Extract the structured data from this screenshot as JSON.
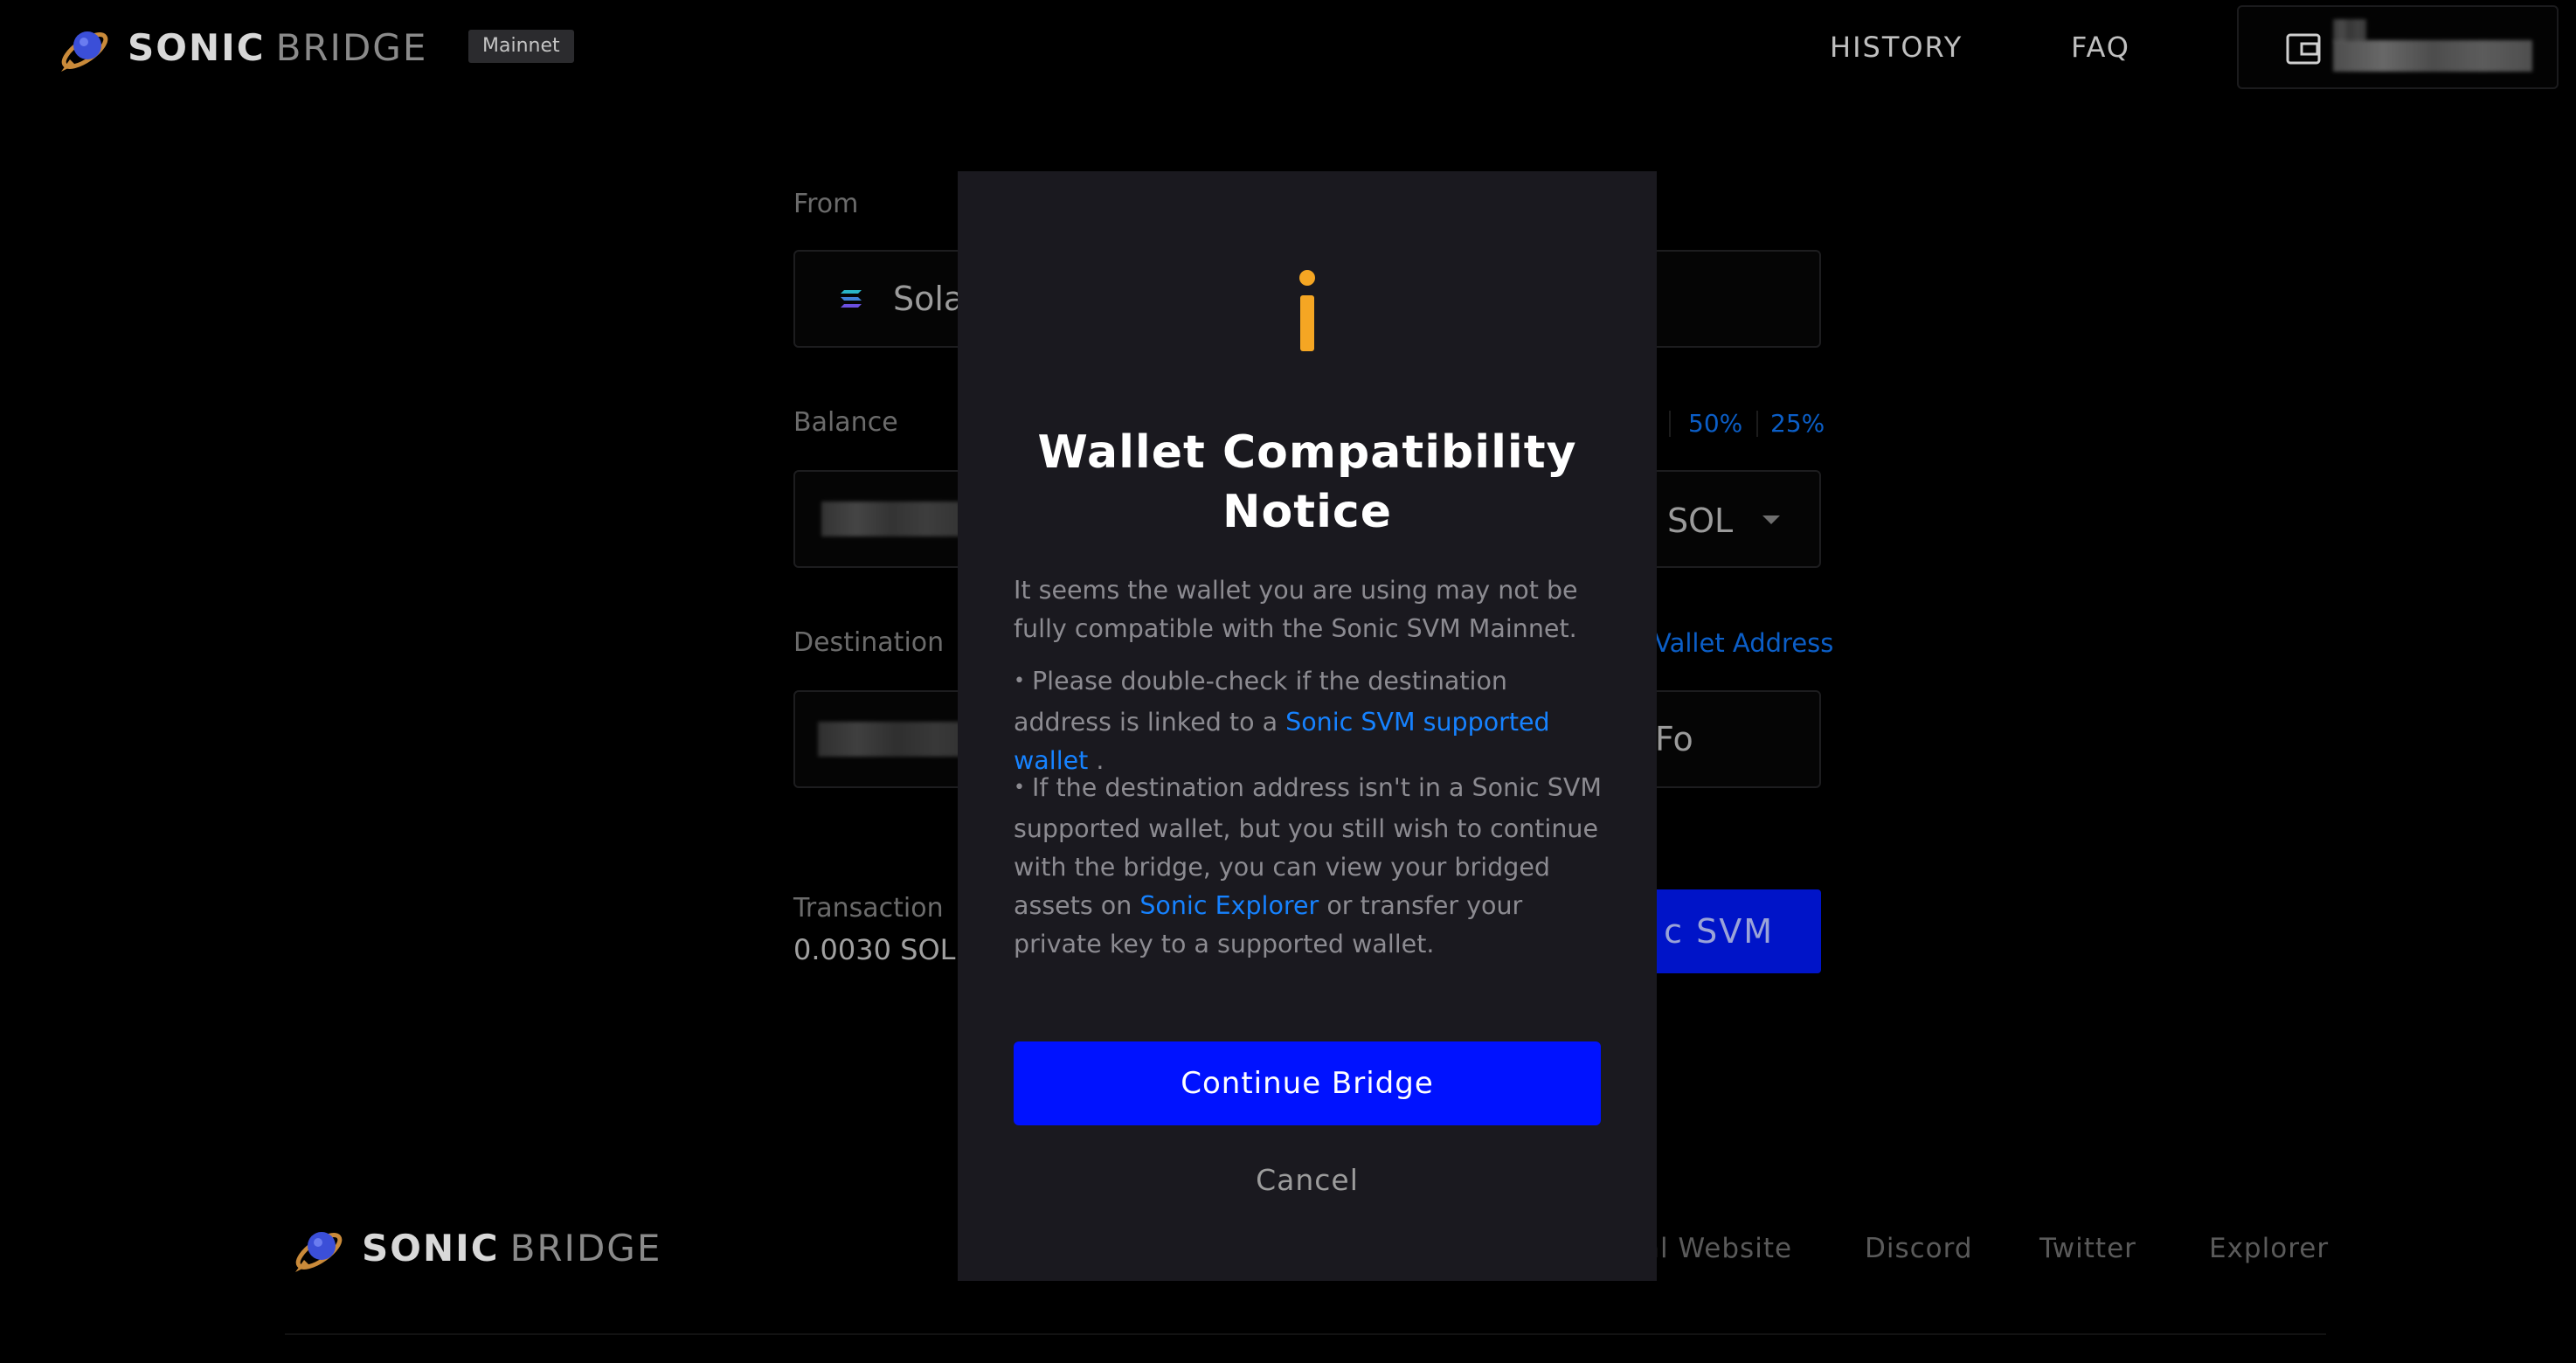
{
  "header": {
    "brand_bold": "SONIC",
    "brand_light": "BRIDGE",
    "network_badge": "Mainnet",
    "nav": [
      {
        "label": "HISTORY"
      },
      {
        "label": "FAQ"
      }
    ],
    "wallet_icon": "wallet-icon"
  },
  "form": {
    "from_label": "From",
    "from_chain": "Sola",
    "balance_label": "Balance",
    "pct_50": "50%",
    "pct_25": "25%",
    "token": "SOL",
    "destination_label": "Destination",
    "destination_link": "Vallet Address",
    "destination_value_tail": "Fo",
    "fee_label": "Transaction",
    "fee_value": "0.0030 SOL",
    "bridge_button": "c SVM"
  },
  "footer": {
    "brand_bold": "SONIC",
    "brand_light": "BRIDGE",
    "links": [
      {
        "label": "al Website"
      },
      {
        "label": "Discord"
      },
      {
        "label": "Twitter"
      },
      {
        "label": "Explorer"
      }
    ]
  },
  "modal": {
    "icon": "info-icon",
    "title_line1": "Wallet Compatibility",
    "title_line2": "Notice",
    "intro": "It seems the wallet you are using may not be fully compatible with the Sonic SVM Mainnet.",
    "bullet1_text": "Please double-check if the destination address is linked to a",
    "bullet1_link": "Sonic SVM supported wallet",
    "bullet1_end": ".",
    "bullet2_text": "If the destination address isn't in a Sonic SVM supported wallet, but you still wish to continue with the bridge, you can view your bridged assets on",
    "bullet2_link": "Sonic Explorer",
    "bullet2_end": "or transfer your private key to a supported wallet.",
    "continue_button": "Continue Bridge",
    "cancel_button": "Cancel"
  },
  "colors": {
    "accent_blue": "#0012ff",
    "link_blue": "#1682ff",
    "info_orange": "#f5a623",
    "modal_bg": "#1a191f"
  }
}
